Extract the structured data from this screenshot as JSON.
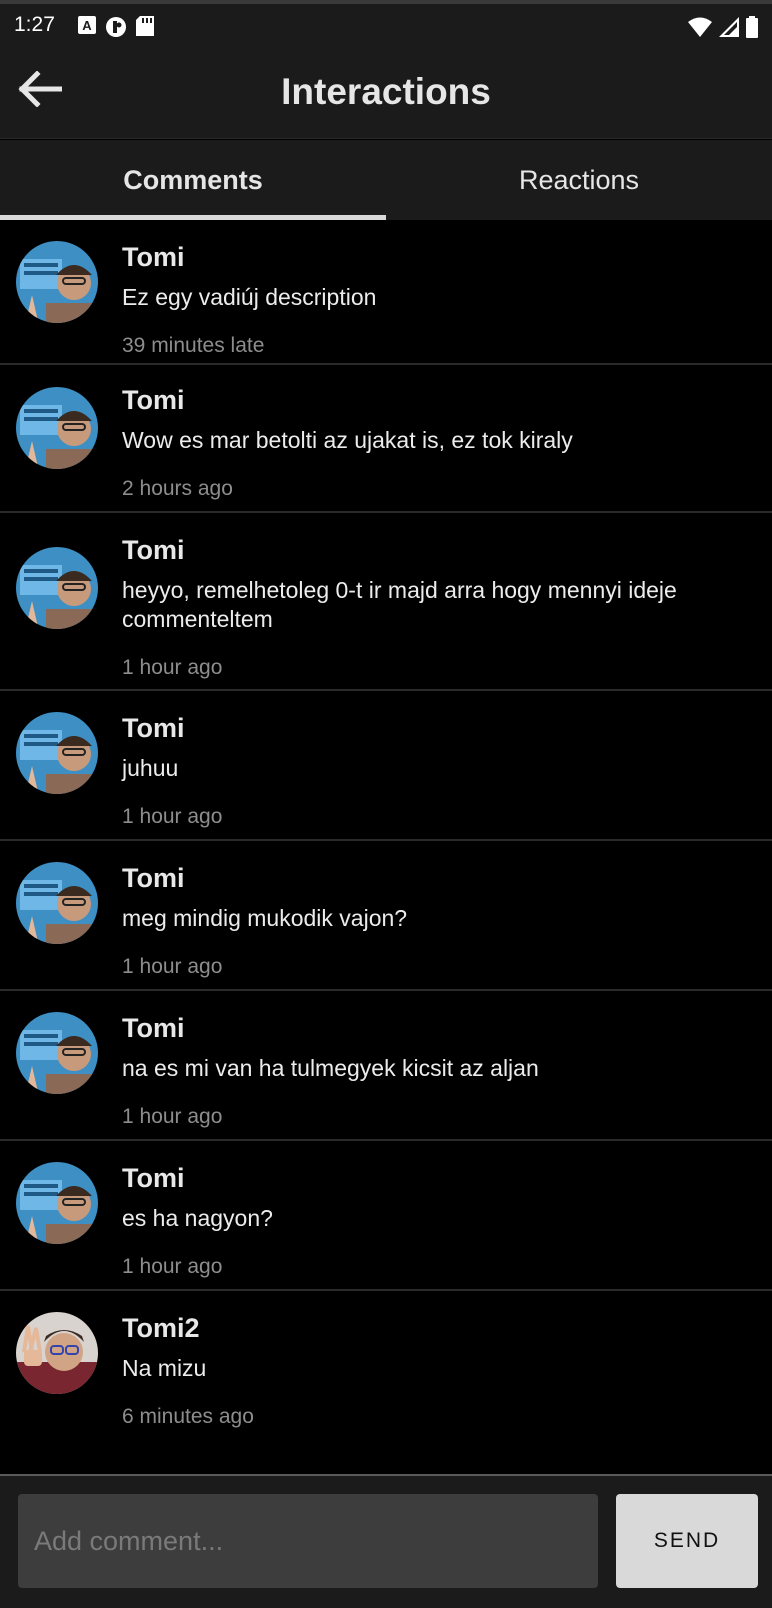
{
  "status_bar": {
    "time": "1:27",
    "left_icons": [
      "font-a-icon",
      "eye-badge-icon",
      "sd-card-icon"
    ],
    "right_icons": [
      "wifi-icon",
      "cell-signal-icon",
      "battery-icon"
    ]
  },
  "app_bar": {
    "back_icon": "arrow-left-icon",
    "title": "Interactions"
  },
  "tabs": [
    {
      "label": "Comments",
      "active": true
    },
    {
      "label": "Reactions",
      "active": false
    }
  ],
  "comments": [
    {
      "author": "Tomi",
      "text": "Ez egy vadiúj description",
      "time": "39 minutes late"
    },
    {
      "author": "Tomi",
      "text": "Wow es mar betolti az ujakat is, ez tok kiraly",
      "time": "2 hours ago"
    },
    {
      "author": "Tomi",
      "text": "heyyo, remelhetoleg 0-t ir majd arra hogy mennyi ideje commenteltem",
      "time": "1 hour ago"
    },
    {
      "author": "Tomi",
      "text": "juhuu",
      "time": "1 hour ago"
    },
    {
      "author": "Tomi",
      "text": "meg mindig mukodik vajon?",
      "time": "1 hour ago"
    },
    {
      "author": "Tomi",
      "text": "na es mi van ha tulmegyek kicsit az aljan",
      "time": "1 hour ago"
    },
    {
      "author": "Tomi",
      "text": "es ha nagyon?",
      "time": "1 hour ago"
    },
    {
      "author": "Tomi2",
      "text": "Na mizu",
      "time": "6 minutes ago"
    }
  ],
  "composer": {
    "placeholder": "Add comment...",
    "value": "",
    "send_label": "SEND"
  }
}
